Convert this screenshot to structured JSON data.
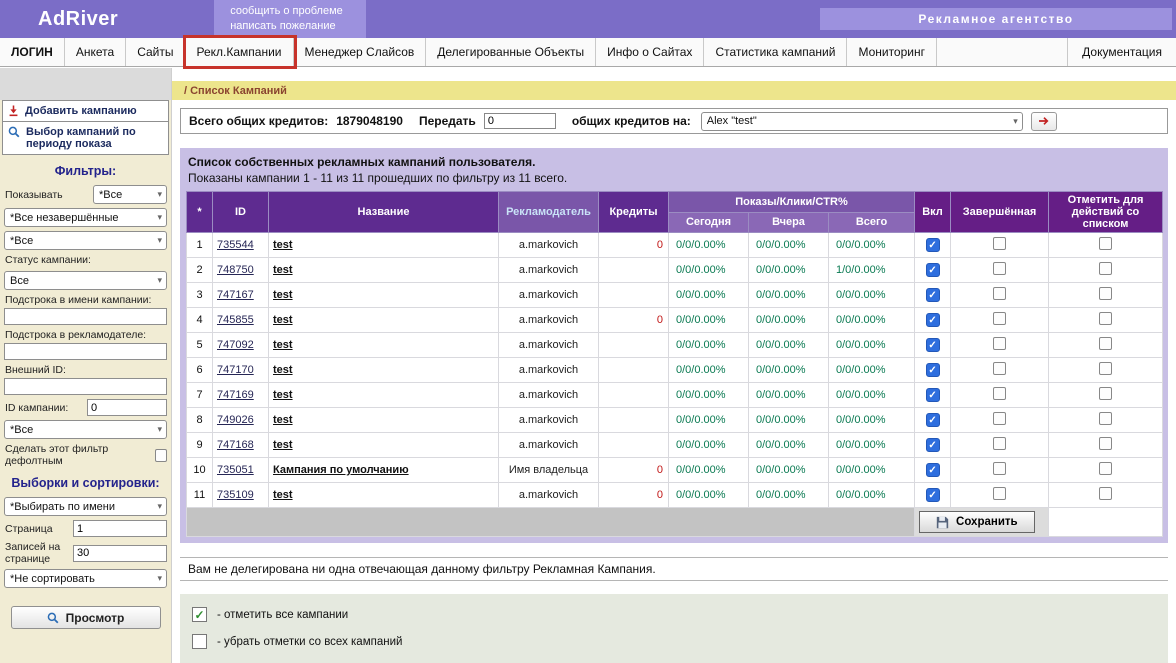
{
  "header": {
    "logo": "AdRiver",
    "report_problem": "сообщить о проблеме",
    "write_wish": "написать пожелание",
    "agency": "Рекламное агентство"
  },
  "nav": {
    "tabs": [
      {
        "label": "ЛОГИН",
        "bold": true
      },
      {
        "label": "Анкета"
      },
      {
        "label": "Сайты"
      },
      {
        "label": "Рекл.Кампании",
        "highlighted": true
      },
      {
        "label": "Менеджер Слайсов"
      },
      {
        "label": "Делегированные Объекты"
      },
      {
        "label": "Инфо о Сайтах"
      },
      {
        "label": "Статистика кампаний"
      },
      {
        "label": "Мониторинг"
      }
    ],
    "right_tab": "Документация"
  },
  "breadcrumb": "/ Список Кампаний",
  "sidebar": {
    "add_campaign": "Добавить кампанию",
    "select_by_period": "Выбор кампаний по периоду показа",
    "filters_title": "Фильтры:",
    "show_label": "Показывать",
    "show_value": "*Все",
    "unfinished_value": "*Все незавершённые",
    "all_value": "*Все",
    "status_label": "Статус кампании:",
    "status_value": "Все",
    "substring_name_label": "Подстрока в имени кампании:",
    "substring_adv_label": "Подстрока в рекламодателе:",
    "external_id_label": "Внешний ID:",
    "campaign_id_label": "ID кампании:",
    "campaign_id_value": "0",
    "filter_all_value": "*Все",
    "default_filter_label": "Сделать этот фильтр дефолтным",
    "selections_title": "Выборки и сортировки:",
    "select_by_name_value": "*Выбирать по имени",
    "page_label": "Страница",
    "page_value": "1",
    "records_label": "Записей на странице",
    "records_value": "30",
    "sort_value": "*Не сортировать",
    "view_button": "Просмотр"
  },
  "credits_bar": {
    "total_label": "Всего общих кредитов:",
    "total_value": "1879048190",
    "transfer_label": "Передать",
    "transfer_value": "0",
    "to_label": "общих кредитов на:",
    "recipient": "Alex \"test\""
  },
  "campaign_table": {
    "title": "Список собственных рекламных кампаний пользователя.",
    "subtitle": "Показаны кампании 1 - 11 из 11 прошедших по фильтру из 11 всего.",
    "columns": {
      "num": "*",
      "id": "ID",
      "name": "Название",
      "advertiser": "Рекламодатель",
      "credits": "Кредиты",
      "stats": "Показы/Клики/CTR%",
      "today": "Сегодня",
      "yesterday": "Вчера",
      "total": "Всего",
      "enabled": "Вкл",
      "finished": "Завершённая",
      "mark": "Отметить для действий со списком"
    },
    "save_button": "Сохранить",
    "rows": [
      {
        "id": "735544",
        "name": "test",
        "advertiser": "a.markovich",
        "credits": "0",
        "today": "0/0/0.00%",
        "yesterday": "0/0/0.00%",
        "total": "0/0/0.00%",
        "enabled": true,
        "finished": false,
        "marked": false
      },
      {
        "id": "748750",
        "name": "test",
        "advertiser": "a.markovich",
        "credits": "",
        "today": "0/0/0.00%",
        "yesterday": "0/0/0.00%",
        "total": "1/0/0.00%",
        "enabled": true,
        "finished": false,
        "marked": false
      },
      {
        "id": "747167",
        "name": "test",
        "advertiser": "a.markovich",
        "credits": "",
        "today": "0/0/0.00%",
        "yesterday": "0/0/0.00%",
        "total": "0/0/0.00%",
        "enabled": true,
        "finished": false,
        "marked": false
      },
      {
        "id": "745855",
        "name": "test",
        "advertiser": "a.markovich",
        "credits": "0",
        "today": "0/0/0.00%",
        "yesterday": "0/0/0.00%",
        "total": "0/0/0.00%",
        "enabled": true,
        "finished": false,
        "marked": false
      },
      {
        "id": "747092",
        "name": "test",
        "advertiser": "a.markovich",
        "credits": "",
        "today": "0/0/0.00%",
        "yesterday": "0/0/0.00%",
        "total": "0/0/0.00%",
        "enabled": true,
        "finished": false,
        "marked": false
      },
      {
        "id": "747170",
        "name": "test",
        "advertiser": "a.markovich",
        "credits": "",
        "today": "0/0/0.00%",
        "yesterday": "0/0/0.00%",
        "total": "0/0/0.00%",
        "enabled": true,
        "finished": false,
        "marked": false
      },
      {
        "id": "747169",
        "name": "test",
        "advertiser": "a.markovich",
        "credits": "",
        "today": "0/0/0.00%",
        "yesterday": "0/0/0.00%",
        "total": "0/0/0.00%",
        "enabled": true,
        "finished": false,
        "marked": false
      },
      {
        "id": "749026",
        "name": "test",
        "advertiser": "a.markovich",
        "credits": "",
        "today": "0/0/0.00%",
        "yesterday": "0/0/0.00%",
        "total": "0/0/0.00%",
        "enabled": true,
        "finished": false,
        "marked": false
      },
      {
        "id": "747168",
        "name": "test",
        "advertiser": "a.markovich",
        "credits": "",
        "today": "0/0/0.00%",
        "yesterday": "0/0/0.00%",
        "total": "0/0/0.00%",
        "enabled": true,
        "finished": false,
        "marked": false
      },
      {
        "id": "735051",
        "name": "Кампания по умолчанию",
        "advertiser": "Имя владельца",
        "credits": "0",
        "today": "0/0/0.00%",
        "yesterday": "0/0/0.00%",
        "total": "0/0/0.00%",
        "enabled": true,
        "finished": false,
        "marked": false
      },
      {
        "id": "735109",
        "name": "test",
        "advertiser": "a.markovich",
        "credits": "0",
        "today": "0/0/0.00%",
        "yesterday": "0/0/0.00%",
        "total": "0/0/0.00%",
        "enabled": true,
        "finished": false,
        "marked": false
      }
    ]
  },
  "messages": {
    "not_delegated": "Вам не делегирована ни одна отвечающая данному фильтру Рекламная Кампания.",
    "legend_check_all": "- отметить все кампании",
    "legend_uncheck_all": "- убрать отметки со всех кампаний"
  }
}
